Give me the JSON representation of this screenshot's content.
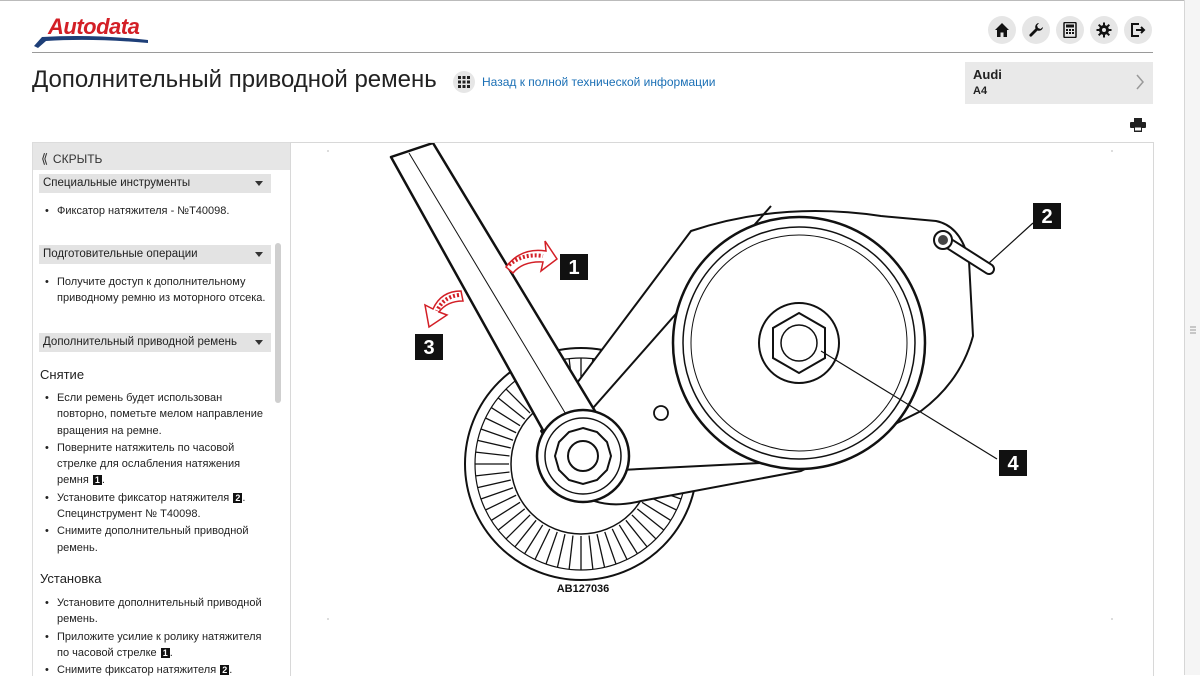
{
  "header": {
    "logo_text": "Autodata",
    "icons": [
      "home-icon",
      "wrench-icon",
      "calculator-icon",
      "gear-icon",
      "logout-icon"
    ]
  },
  "page": {
    "title": "Дополнительный приводной ремень",
    "back_link": "Назад к полной технической информации"
  },
  "vehicle": {
    "make": "Audi",
    "model": "A4"
  },
  "sidebar": {
    "hide_label": "СКРЫТЬ",
    "sections": [
      {
        "title": "Специальные инструменты",
        "items": [
          "Фиксатор натяжителя - №T40098."
        ]
      },
      {
        "title": "Подготовительные операции",
        "items": [
          "Получите доступ к дополнительному приводному ремню из моторного отсека."
        ]
      },
      {
        "title": "Дополнительный приводной ремень"
      }
    ],
    "removal": {
      "heading": "Снятие",
      "items": [
        {
          "text": "Если ремень будет использован повторно, пометьте мелом направление вращения на ремне."
        },
        {
          "text": "Поверните натяжитель по часовой стрелке для ослабления натяжения ремня",
          "badge": "1",
          "suffix": "."
        },
        {
          "text": "Установите фиксатор натяжителя",
          "badge": "2",
          "suffix": ".",
          "extra": "Специнструмент № T40098."
        },
        {
          "text": "Снимите дополнительный приводной ремень."
        }
      ]
    },
    "install": {
      "heading": "Установка",
      "items": [
        {
          "text": "Установите дополнительный приводной ремень."
        },
        {
          "text": "Приложите усилие к ролику натяжителя по часовой стрелке",
          "badge": "1",
          "suffix": "."
        },
        {
          "text": "Снимите фиксатор натяжителя",
          "badge": "2",
          "suffix": "."
        }
      ]
    }
  },
  "figure": {
    "code": "AB127036",
    "callouts": [
      "1",
      "2",
      "3",
      "4"
    ]
  },
  "colors": {
    "brand_red": "#d31f26",
    "link_blue": "#1a6fb5"
  }
}
